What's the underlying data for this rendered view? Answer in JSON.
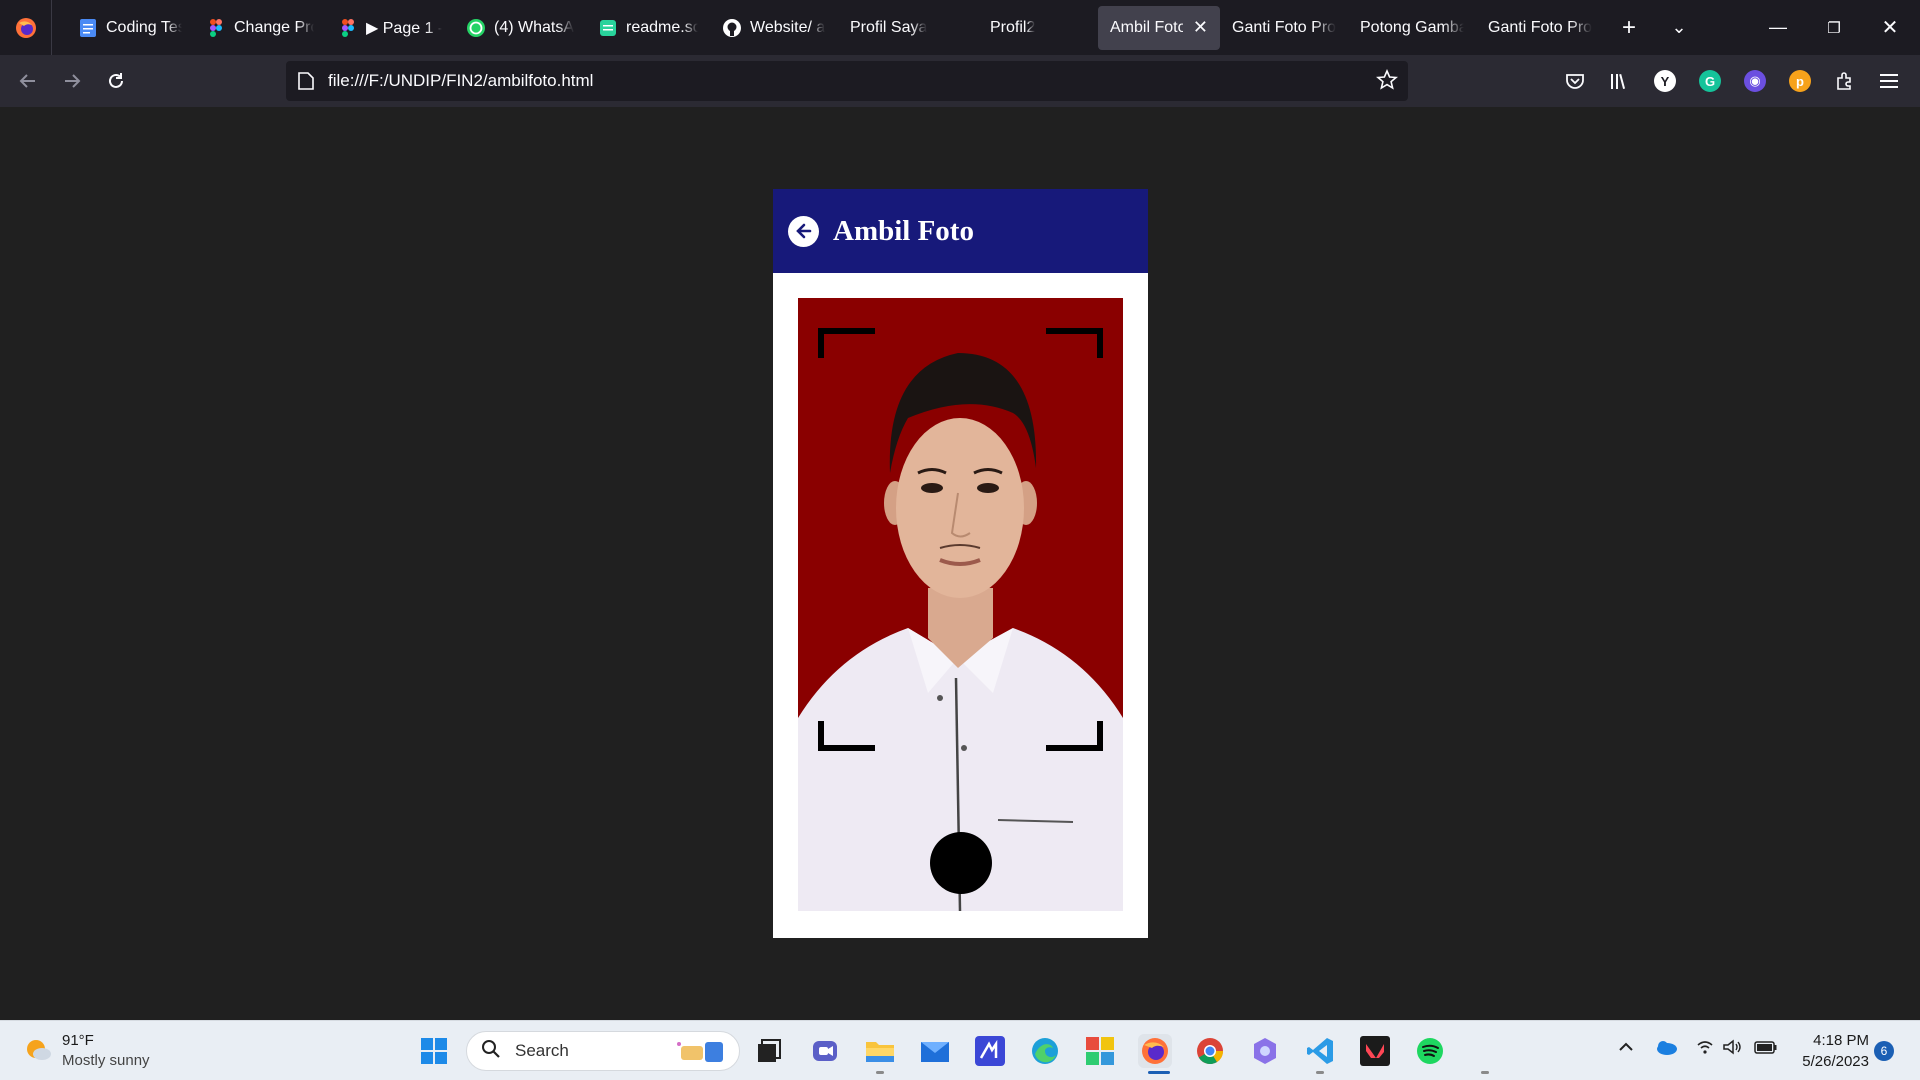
{
  "browser": {
    "tabs": [
      {
        "label": "Coding Tes",
        "icon": "google-docs-icon"
      },
      {
        "label": "Change Pro",
        "icon": "figma-icon"
      },
      {
        "label": "▶ Page 1 -",
        "icon": "figma-icon"
      },
      {
        "label": "(4) WhatsA",
        "icon": "whatsapp-icon"
      },
      {
        "label": "readme.so",
        "icon": "readme-icon"
      },
      {
        "label": "Website/ a",
        "icon": "github-icon"
      },
      {
        "label": "Profil Saya",
        "icon": ""
      },
      {
        "label": "Profil2",
        "icon": ""
      },
      {
        "label": "Ambil Foto",
        "icon": "",
        "active": true
      },
      {
        "label": "Ganti Foto Prof",
        "icon": ""
      },
      {
        "label": "Potong Gamba",
        "icon": ""
      },
      {
        "label": "Ganti Foto Prof",
        "icon": ""
      }
    ],
    "url": "file:///F:/UNDIP/FIN2/ambilfoto.html"
  },
  "app": {
    "title": "Ambil Foto",
    "header_color": "#17197a",
    "viewfinder_color": "#8a0000"
  },
  "taskbar": {
    "weather_temp": "91°F",
    "weather_desc": "Mostly sunny",
    "search_placeholder": "Search",
    "time": "4:18 PM",
    "date": "5/26/2023",
    "notification_count": "6"
  }
}
